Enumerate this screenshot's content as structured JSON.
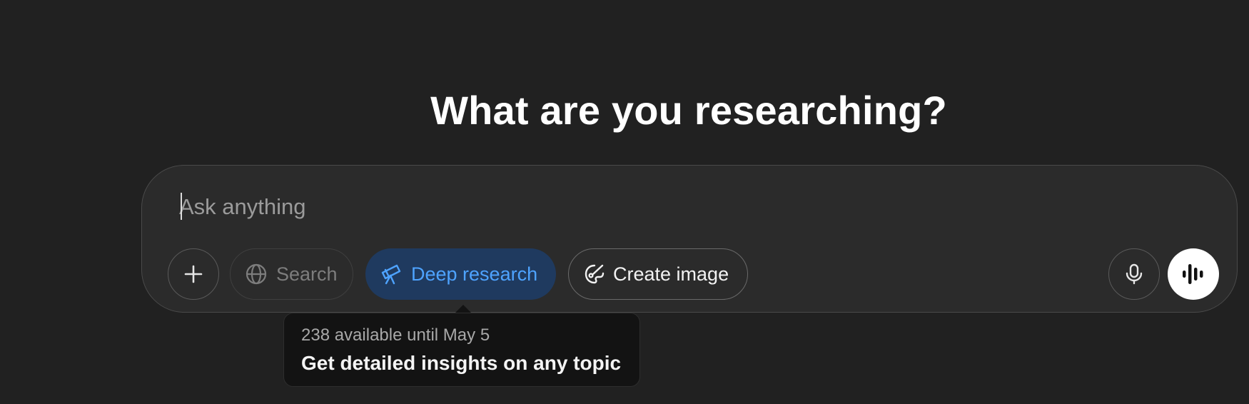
{
  "heading": "What are you researching?",
  "composer": {
    "placeholder": "Ask anything",
    "value": ""
  },
  "toolbar": {
    "plus_icon": "plus-icon",
    "search_label": "Search",
    "search_icon": "globe-icon",
    "deep_research_label": "Deep research",
    "deep_research_icon": "telescope-icon",
    "create_image_label": "Create image",
    "create_image_icon": "palette-icon",
    "mic_icon": "microphone-icon",
    "voice_icon": "voice-waveform-icon"
  },
  "tooltip": {
    "subtitle": "238 available until May 5",
    "title": "Get detailed insights on any topic"
  },
  "colors": {
    "background": "#212121",
    "composer": "#2b2b2b",
    "deep_research_bg": "#1f3a5f",
    "deep_research_fg": "#4ea3ff",
    "tooltip_bg": "#131313"
  }
}
